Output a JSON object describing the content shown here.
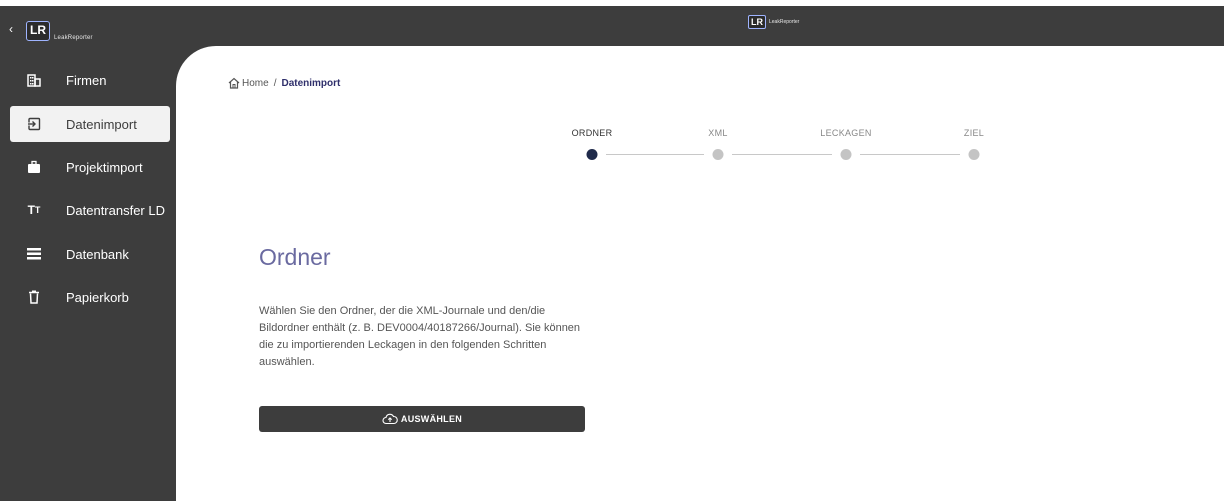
{
  "app": {
    "logo_short": "LR",
    "logo_name": "LeakReporter",
    "center_logo_short": "LR",
    "center_logo_name": "LeakReporter",
    "collapse_icon": "chevron-left-icon"
  },
  "colors": {
    "sidebar_bg": "#3d3d3d",
    "accent_title": "#6a6aa0",
    "breadcrumb_current": "#2f2f6b",
    "step_active": "#1f2a4a",
    "step_inactive": "#c4c4c4"
  },
  "sidebar": {
    "items": [
      {
        "label": "Firmen",
        "icon": "building-icon",
        "active": false
      },
      {
        "label": "Datenimport",
        "icon": "import-icon",
        "active": true
      },
      {
        "label": "Projektimport",
        "icon": "briefcase-icon",
        "active": false
      },
      {
        "label": "Datentransfer LD",
        "icon": "text-size-icon",
        "active": false
      },
      {
        "label": "Datenbank",
        "icon": "list-icon",
        "active": false
      },
      {
        "label": "Papierkorb",
        "icon": "trash-icon",
        "active": false
      }
    ]
  },
  "breadcrumb": {
    "home": "Home",
    "separator": "/",
    "current": "Datenimport"
  },
  "stepper": {
    "steps": [
      {
        "label": "ORDNER",
        "active": true
      },
      {
        "label": "XML",
        "active": false
      },
      {
        "label": "LECKAGEN",
        "active": false
      },
      {
        "label": "ZIEL",
        "active": false
      }
    ]
  },
  "content": {
    "title": "Ordner",
    "description": "Wählen Sie den Ordner, der die XML-Journale und den/die Bildordner enthält (z. B. DEV0004/40187266/Journal). Sie können die zu importierenden Leckagen in den folgenden Schritten auswählen.",
    "button_label": "AUSWÄHLEN",
    "button_icon": "cloud-upload-icon"
  }
}
